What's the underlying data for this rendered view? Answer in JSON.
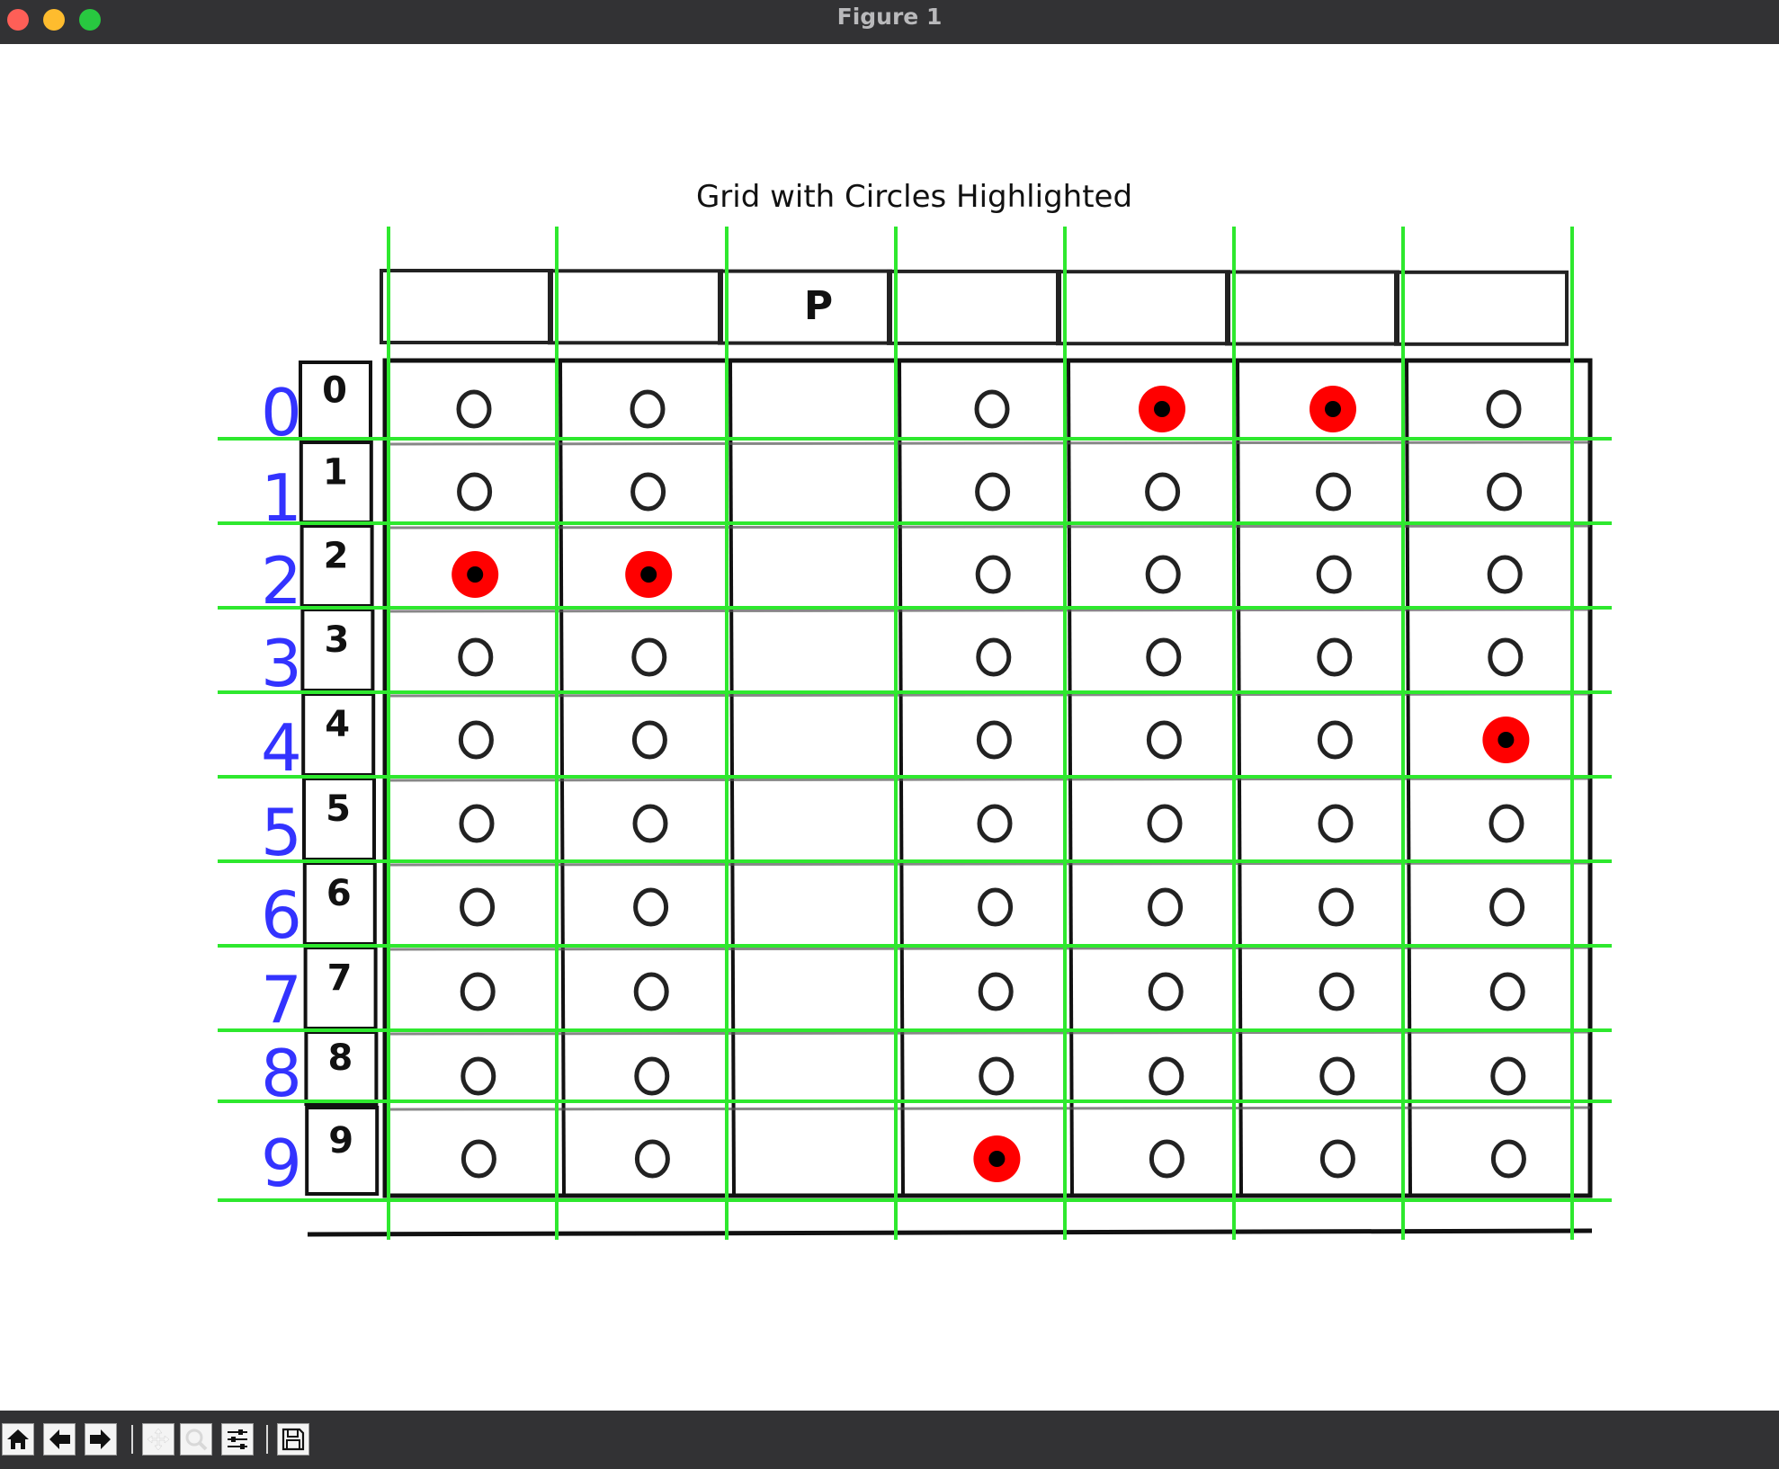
{
  "window": {
    "title": "Figure 1",
    "controls": [
      "close",
      "minimize",
      "maximize"
    ]
  },
  "figure": {
    "title": "Grid with Circles Highlighted",
    "header_letter": "P",
    "row_numbers": [
      "0",
      "1",
      "2",
      "3",
      "4",
      "5",
      "6",
      "7",
      "8",
      "9"
    ],
    "blue_row_labels": [
      "0",
      "1",
      "2",
      "3",
      "4",
      "5",
      "6",
      "7",
      "8",
      "9"
    ],
    "bubble_columns": 7,
    "filled_bubbles": [
      {
        "row": 0,
        "col": 4
      },
      {
        "row": 0,
        "col": 5
      },
      {
        "row": 2,
        "col": 0
      },
      {
        "row": 2,
        "col": 1
      },
      {
        "row": 4,
        "col": 6
      },
      {
        "row": 9,
        "col": 3
      }
    ],
    "colors": {
      "grid_lines": "#2ee82e",
      "row_labels": "#3333ff",
      "highlight_ring": "#ff0000",
      "highlight_center": "#000000"
    }
  },
  "toolbar": {
    "buttons": [
      {
        "icon": "home-icon"
      },
      {
        "icon": "back-arrow-icon"
      },
      {
        "icon": "forward-arrow-icon"
      },
      {
        "icon": "pan-icon"
      },
      {
        "icon": "zoom-icon"
      },
      {
        "icon": "configure-subplots-icon"
      },
      {
        "icon": "save-icon"
      }
    ]
  }
}
